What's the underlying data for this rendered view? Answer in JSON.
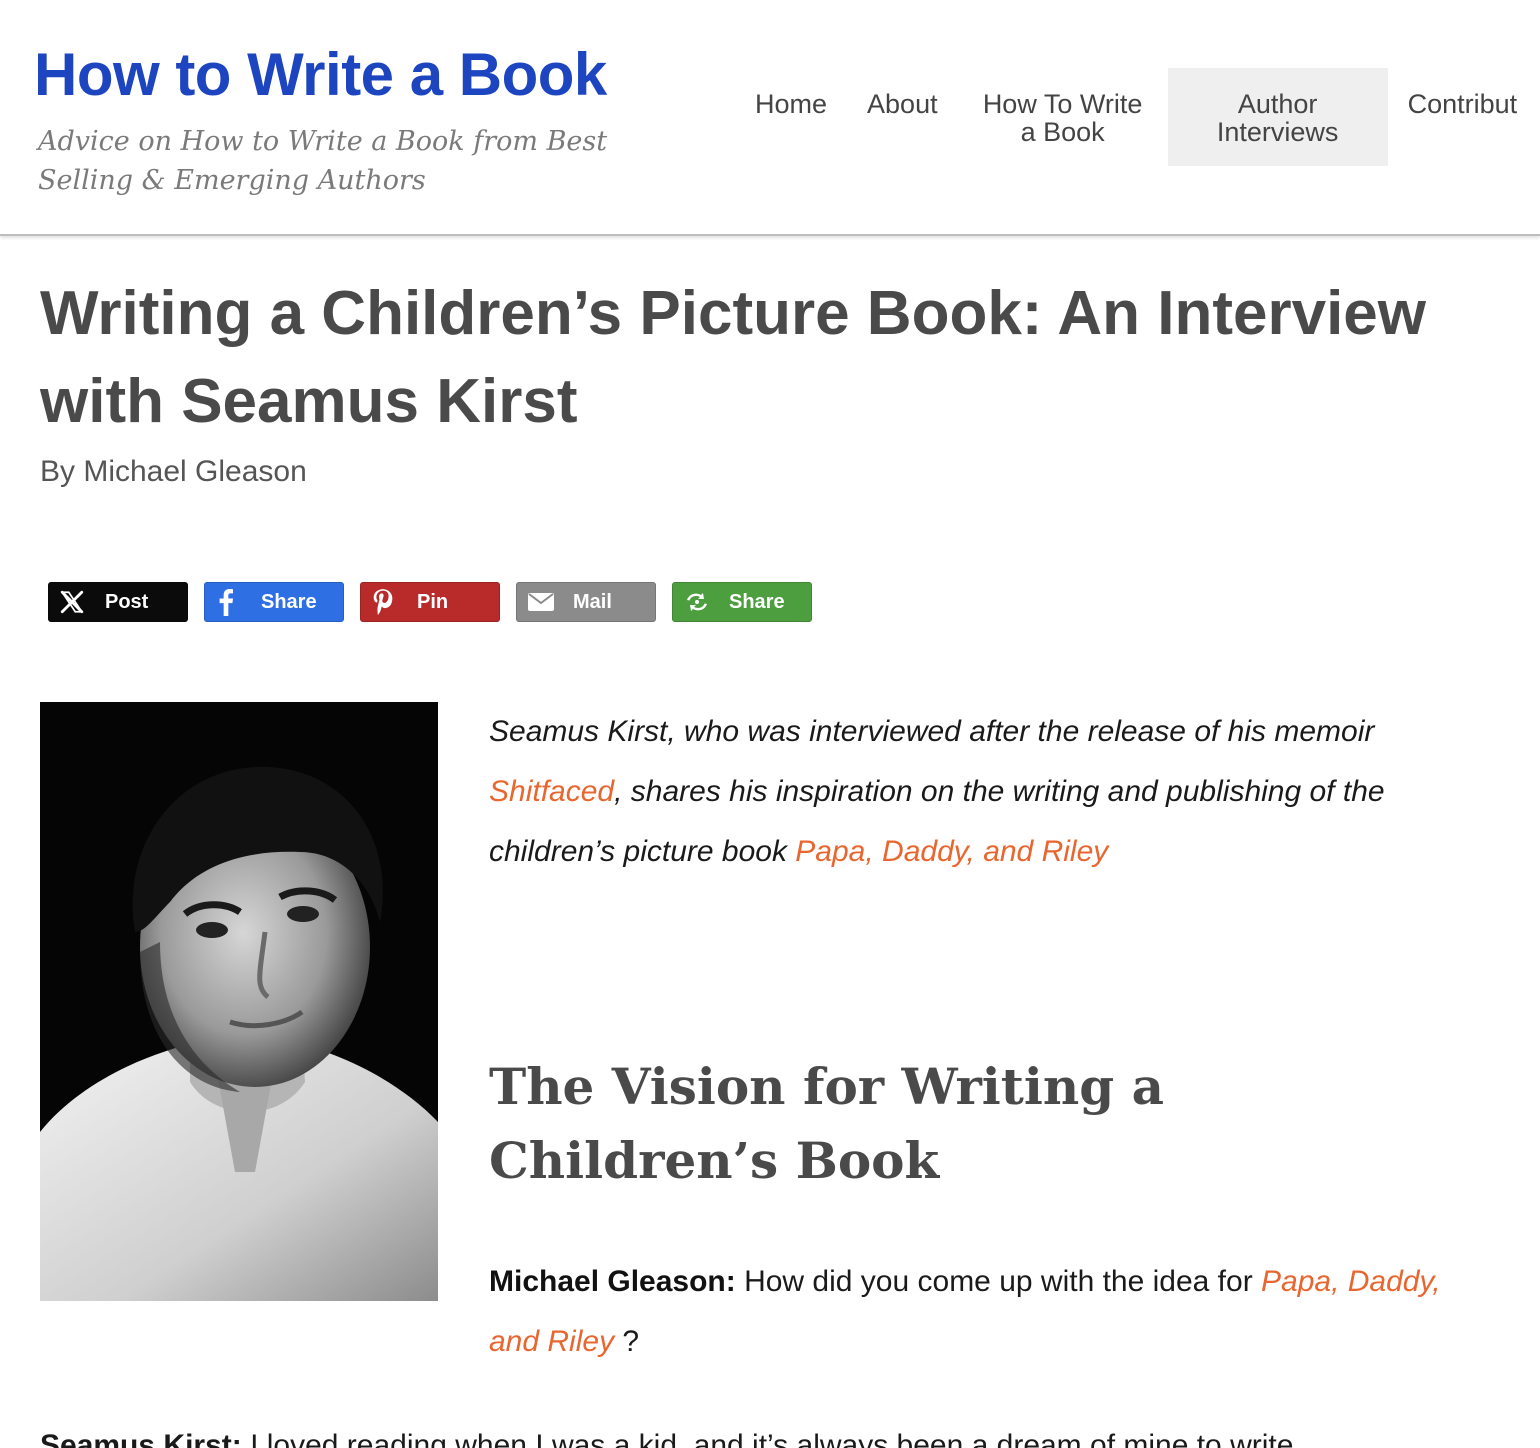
{
  "site": {
    "title": "How to Write a Book",
    "tagline": "Advice on How to Write a Book from Best Selling & Emerging Authors",
    "brand_color": "#1e45c0"
  },
  "nav": {
    "items": [
      {
        "label": "Home"
      },
      {
        "label": "About"
      },
      {
        "label": "How To Write a Book"
      },
      {
        "label": "Author Interviews",
        "active": true
      },
      {
        "label": "Contribut"
      }
    ]
  },
  "article": {
    "title": "Writing a Children’s Picture Book: An Interview with Seamus Kirst",
    "byline": "By Michael Gleason",
    "intro": {
      "part1": "Seamus Kirst, who was interviewed after the release of his memoir ",
      "link1": "Shitfaced",
      "part2": ", shares his inspiration on the writing and publishing of the children’s picture book ",
      "link2": "Papa, Daddy, and Riley"
    },
    "section_heading": "The Vision for Writing a Children’s Book",
    "qa1": {
      "speaker": "Michael Gleason:",
      "text": " How did you come up with the idea for ",
      "link": "Papa, Daddy, and Riley",
      "end": " ?"
    },
    "next_line": {
      "speaker": "Seamus Kirst:",
      "text": " I loved reading when I was a kid, and it’s always been a dream of mine to write"
    },
    "link_color": "#e8662f"
  },
  "share": {
    "buttons": [
      {
        "label": "Post",
        "icon": "x-icon",
        "color": "#0b0b0b"
      },
      {
        "label": "Share",
        "icon": "facebook-icon",
        "color": "#2f6fe4"
      },
      {
        "label": "Pin",
        "icon": "pinterest-icon",
        "color": "#b92a2a"
      },
      {
        "label": "Mail",
        "icon": "mail-icon",
        "color": "#8b8b8b"
      },
      {
        "label": "Share",
        "icon": "more-share-icon",
        "color": "#4d9e3f"
      }
    ]
  }
}
